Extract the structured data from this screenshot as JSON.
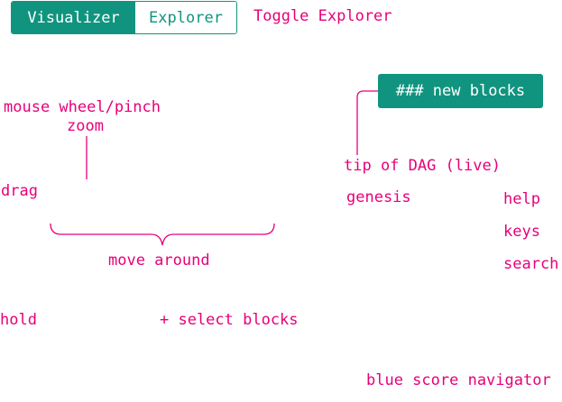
{
  "toggle": {
    "visualizer_label": "Visualizer",
    "explorer_label": "Explorer",
    "toggle_hint": "Toggle Explorer"
  },
  "hints": {
    "zoom_line1": "mouse wheel/pinch",
    "zoom_line2": "zoom",
    "drag": "drag",
    "move_around": "move around",
    "hold": "hold",
    "select_blocks": "+ select blocks",
    "new_blocks": "### new blocks",
    "tip_of_dag": "tip of DAG (live)",
    "genesis": "genesis",
    "help": "help",
    "keys": "keys",
    "search": "search",
    "blue_score_navigator": "blue score navigator"
  },
  "colors": {
    "accent": "#10947f",
    "hint_text": "#e6007a",
    "background": "#ffffff"
  }
}
